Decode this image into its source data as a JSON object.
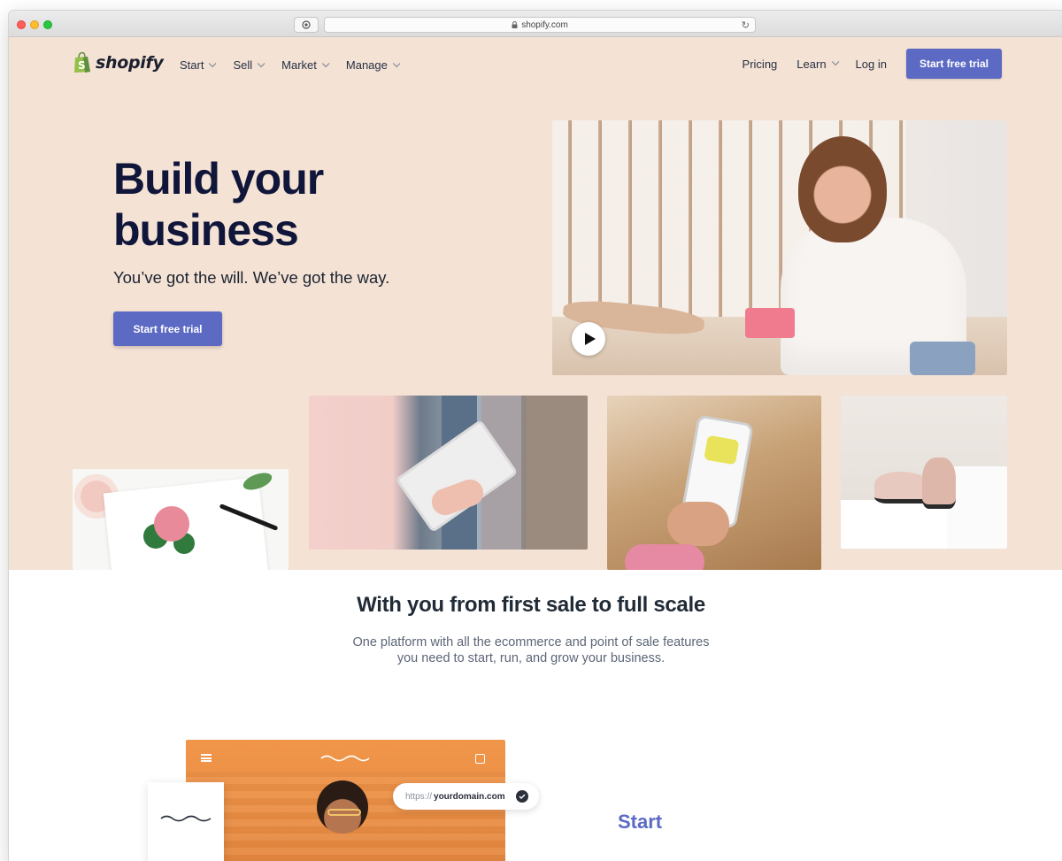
{
  "browser": {
    "url": "shopify.com"
  },
  "header": {
    "logo_text": "shopify",
    "nav_left": [
      {
        "label": "Start"
      },
      {
        "label": "Sell"
      },
      {
        "label": "Market"
      },
      {
        "label": "Manage"
      }
    ],
    "pricing_label": "Pricing",
    "learn_label": "Learn",
    "login_label": "Log in",
    "cta_label": "Start free trial"
  },
  "hero": {
    "title_line1": "Build your",
    "title_line2": "business",
    "subtitle": "You’ve got the will. We’ve got the way.",
    "cta_label": "Start free trial"
  },
  "features": {
    "title": "With you from first sale to full scale",
    "description_line1": "One platform with all the ecommerce and point of sale features",
    "description_line2": "you need to start, run, and grow your business."
  },
  "mockup": {
    "domain_prefix": "https://",
    "domain_name": "yourdomain.com",
    "start_heading": "Start"
  },
  "colors": {
    "hero_background": "#f4e2d4",
    "accent": "#5c6ac4",
    "heading": "#10163a",
    "storefront": "#ef9449"
  },
  "icons": {
    "logo": "shopping-bag-icon",
    "play": "play-icon",
    "check": "check-circle-icon",
    "menu": "menu-icon",
    "bag": "bag-icon"
  }
}
